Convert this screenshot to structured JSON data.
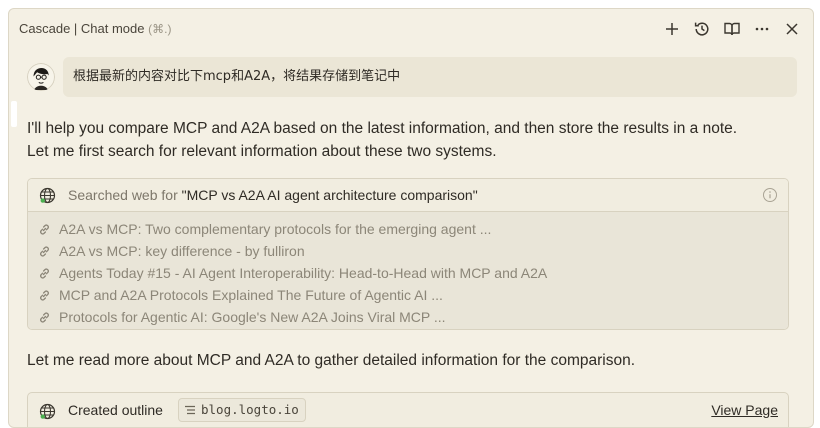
{
  "header": {
    "title": "Cascade | Chat mode",
    "shortcut": "(⌘.)",
    "actions": [
      {
        "name": "new-chat",
        "icon": "plus-icon"
      },
      {
        "name": "history",
        "icon": "history-icon"
      },
      {
        "name": "docs",
        "icon": "book-icon"
      },
      {
        "name": "more",
        "icon": "more-icon"
      },
      {
        "name": "close",
        "icon": "close-icon"
      }
    ]
  },
  "user_message": {
    "text": "根据最新的内容对比下mcp和A2A，将结果存储到笔记中"
  },
  "assistant": {
    "intro_line1": "I'll help you compare MCP and A2A based on the latest information, and then store the results in a note.",
    "intro_line2": "Let me first search for relevant information about these two systems.",
    "search": {
      "prefix": "Searched web for ",
      "query": "\"MCP vs A2A AI agent architecture comparison\"",
      "results": [
        "A2A vs MCP: Two complementary protocols for the emerging agent ...",
        "A2A vs MCP: key difference - by fulliron",
        "Agents Today #15 - AI Agent Interoperability: Head-to-Head with MCP and A2A",
        "MCP and A2A Protocols Explained The Future of Agentic AI ...",
        "Protocols for Agentic AI: Google's New A2A Joins Viral MCP ..."
      ]
    },
    "follow_up": "Let me read more about MCP and A2A to gather detailed information for the comparison.",
    "outline": {
      "label": "Created outline",
      "url": "blog.logto.io",
      "action": "View Page"
    }
  },
  "colors": {
    "panel_bg": "#f4f0e4",
    "user_bubble_bg": "#ebe6d6",
    "results_bg": "#e9e5d8",
    "muted_text": "#8c8678",
    "border": "#d8d2c0"
  }
}
